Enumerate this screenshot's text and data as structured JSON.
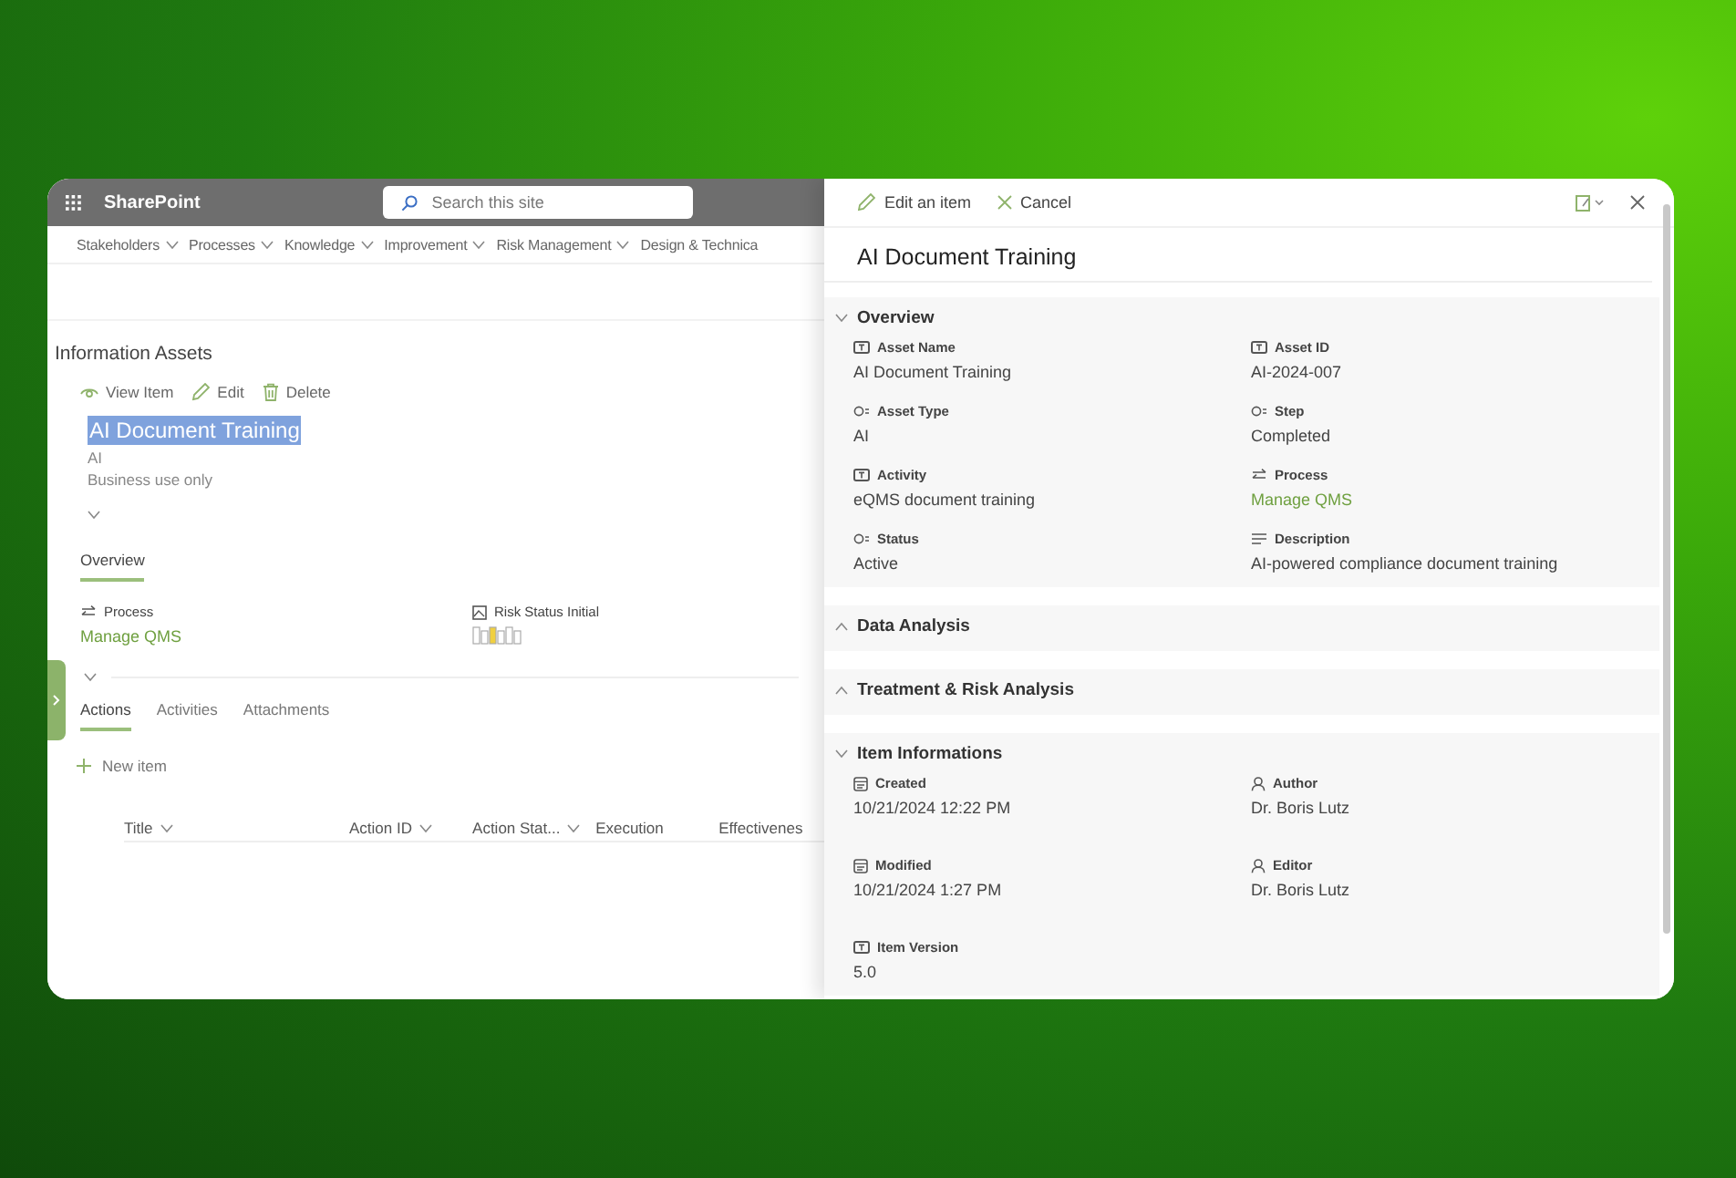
{
  "app": {
    "name": "SharePoint",
    "search": {
      "placeholder": "Search this site"
    }
  },
  "nav": [
    {
      "label": "Stakeholders",
      "dropdown": true
    },
    {
      "label": "Processes",
      "dropdown": true
    },
    {
      "label": "Knowledge",
      "dropdown": true
    },
    {
      "label": "Improvement",
      "dropdown": true
    },
    {
      "label": "Risk Management",
      "dropdown": true
    },
    {
      "label": "Design & Technica",
      "dropdown": false
    }
  ],
  "page": {
    "heading": "Information Assets",
    "commands": [
      {
        "kind": "view",
        "label": "View Item"
      },
      {
        "kind": "edit",
        "label": "Edit"
      },
      {
        "kind": "delete",
        "label": "Delete"
      }
    ],
    "item_title": "AI Document Training",
    "item_title_selected": true,
    "item_lines": [
      "AI",
      "Business use only"
    ],
    "detail_tabs": [
      {
        "label": "Overview",
        "selected": true
      }
    ],
    "fields": [
      {
        "kind": "lookup",
        "label": "Process",
        "value": "Manage QMS"
      },
      {
        "kind": "risk",
        "label": "Risk Status Initial"
      }
    ],
    "tabs": [
      {
        "label": "Actions",
        "selected": true
      },
      {
        "label": "Activities",
        "selected": false
      },
      {
        "label": "Attachments",
        "selected": false
      }
    ],
    "new_item": "New item",
    "columns": [
      {
        "label": "Title",
        "sortable": true
      },
      {
        "label": "Action ID",
        "sortable": true
      },
      {
        "label": "Action Stat...",
        "sortable": true
      },
      {
        "label": "Execution",
        "sortable": false
      },
      {
        "label": "Effectivenes",
        "sortable": false
      }
    ]
  },
  "panel": {
    "actions": [
      {
        "kind": "edit",
        "label": "Edit an item"
      },
      {
        "kind": "cancel",
        "label": "Cancel"
      }
    ],
    "title": "AI Document Training",
    "sections": [
      {
        "title": "Overview",
        "expanded": true,
        "fields": [
          {
            "kind": "text",
            "label": "Asset Name",
            "value": "AI Document Training"
          },
          {
            "kind": "text",
            "label": "Asset ID",
            "value": "AI-2024-007"
          },
          {
            "kind": "choice",
            "label": "Asset Type",
            "value": "AI"
          },
          {
            "kind": "choice",
            "label": "Step",
            "value": "Completed"
          },
          {
            "kind": "text",
            "label": "Activity",
            "value": "eQMS document training"
          },
          {
            "kind": "lookup",
            "label": "Process",
            "value": "Manage QMS"
          },
          {
            "kind": "choice",
            "label": "Status",
            "value": "Active"
          },
          {
            "kind": "note",
            "label": "Description",
            "value": "AI-powered compliance document training"
          }
        ]
      },
      {
        "title": "Data Analysis",
        "expanded": false
      },
      {
        "title": "Treatment & Risk Analysis",
        "expanded": false
      },
      {
        "title": "Item Informations",
        "expanded": true,
        "fields": [
          {
            "kind": "date",
            "label": "Created",
            "value": "10/21/2024 12:22 PM"
          },
          {
            "kind": "person",
            "label": "Author",
            "value": "Dr. Boris Lutz"
          },
          {
            "kind": "date",
            "label": "Modified",
            "value": "10/21/2024 1:27 PM"
          },
          {
            "kind": "person",
            "label": "Editor",
            "value": "Dr. Boris Lutz"
          },
          {
            "kind": "text",
            "label": "Item Version",
            "value": "5.0"
          }
        ]
      }
    ]
  }
}
